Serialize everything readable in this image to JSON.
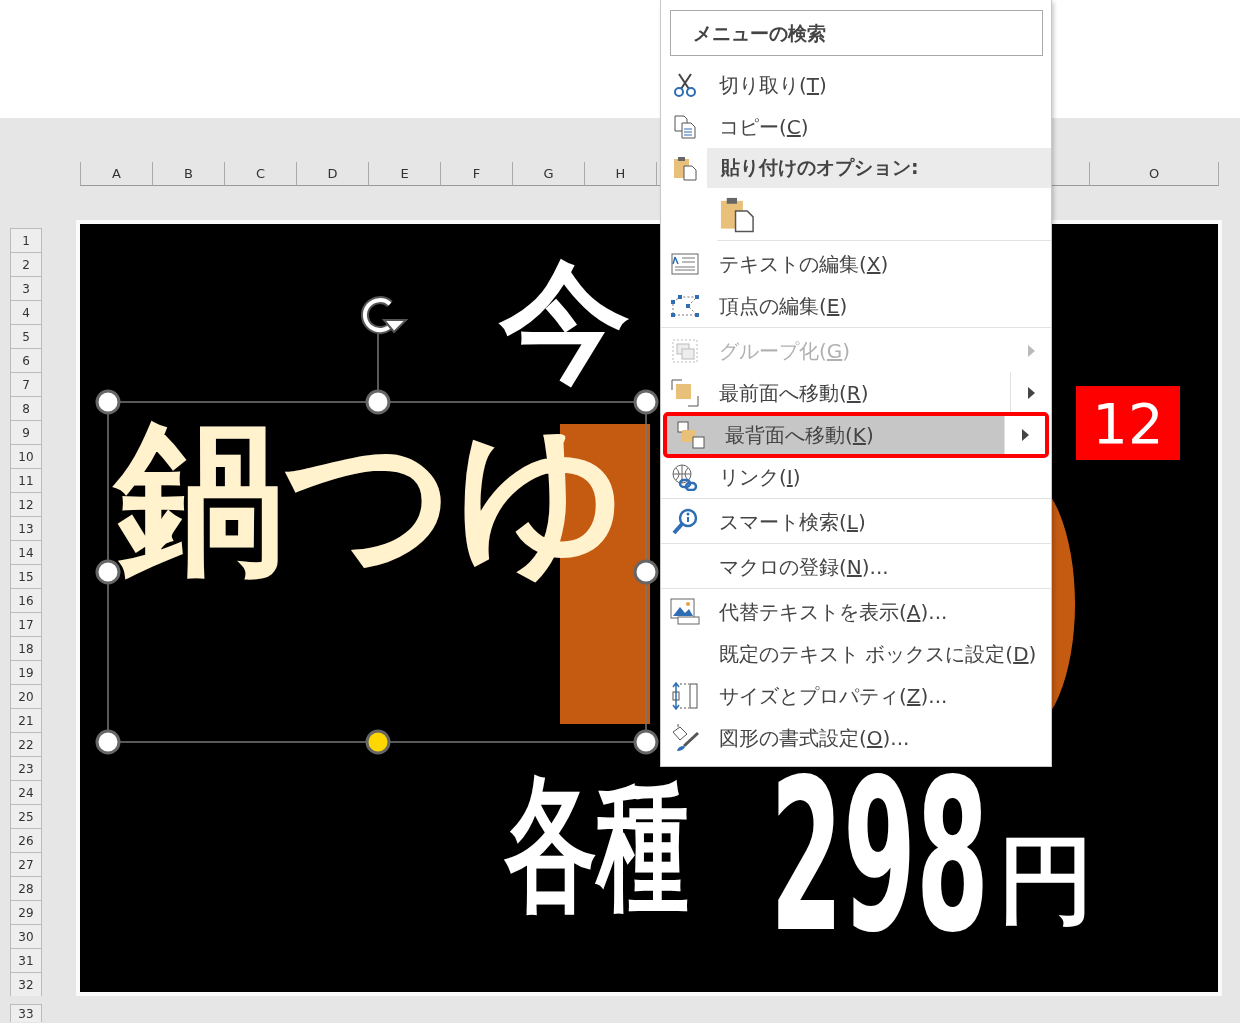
{
  "sheet": {
    "columns": [
      "A",
      "B",
      "C",
      "D",
      "E",
      "F",
      "G",
      "H"
    ],
    "column_right": "O",
    "rows": [
      "1",
      "2",
      "3",
      "4",
      "5",
      "6",
      "7",
      "8",
      "9",
      "10",
      "11",
      "12",
      "13",
      "14",
      "15",
      "16",
      "17",
      "18",
      "19",
      "20",
      "21",
      "22",
      "23",
      "24",
      "25",
      "26",
      "27",
      "28",
      "29",
      "30",
      "31",
      "32"
    ],
    "row_below": "33"
  },
  "poster": {
    "texts": [
      {
        "text": "今",
        "color": "#ffffff"
      },
      {
        "text": "鍋つゆ",
        "color": "#fff2cc"
      },
      {
        "text": "各種",
        "color": "#ffffff"
      },
      {
        "text": "298",
        "color": "#ffffff"
      },
      {
        "text": "円",
        "color": "#ffffff"
      }
    ]
  },
  "context_menu": {
    "search": {
      "placeholder": "メニューの検索"
    },
    "items": [
      {
        "kind": "command",
        "text": "切り取り(",
        "access_key": "T",
        "text_after": ")",
        "disabled": false,
        "submenu": false,
        "selected": false,
        "separator_after": false
      },
      {
        "kind": "command",
        "text": "コピー(",
        "access_key": "C",
        "text_after": ")",
        "disabled": false,
        "submenu": false,
        "selected": false,
        "separator_after": false
      },
      {
        "kind": "header",
        "text": "貼り付けのオプション:"
      },
      {
        "kind": "paste-button",
        "separator_after": true
      },
      {
        "kind": "command",
        "text": "テキストの編集(",
        "access_key": "X",
        "text_after": ")",
        "disabled": false,
        "submenu": false,
        "selected": false,
        "separator_after": false
      },
      {
        "kind": "command",
        "text": "頂点の編集(",
        "access_key": "E",
        "text_after": ")",
        "disabled": false,
        "submenu": false,
        "selected": false,
        "separator_after": true
      },
      {
        "kind": "command",
        "text": "グループ化(",
        "access_key": "G",
        "text_after": ")",
        "disabled": true,
        "submenu": true,
        "selected": false,
        "separator_after": false
      },
      {
        "kind": "command",
        "text": "最前面へ移動(",
        "access_key": "R",
        "text_after": ")",
        "disabled": false,
        "submenu": true,
        "selected": false,
        "separator_after": false
      },
      {
        "kind": "command",
        "text": "最背面へ移動(",
        "access_key": "K",
        "text_after": ")",
        "disabled": false,
        "submenu": true,
        "selected": true,
        "separator_after": false
      },
      {
        "kind": "command",
        "text": "リンク(",
        "access_key": "I",
        "text_after": ")",
        "disabled": false,
        "submenu": false,
        "selected": false,
        "separator_after": true
      },
      {
        "kind": "command",
        "text": "スマート検索(",
        "access_key": "L",
        "text_after": ")",
        "disabled": false,
        "submenu": false,
        "selected": false,
        "separator_after": true
      },
      {
        "kind": "command",
        "text": "マクロの登録(",
        "access_key": "N",
        "text_after": ")...",
        "disabled": false,
        "submenu": false,
        "selected": false,
        "separator_after": true
      },
      {
        "kind": "command",
        "text": "代替テキストを表示(",
        "access_key": "A",
        "text_after": ")...",
        "disabled": false,
        "submenu": false,
        "selected": false,
        "separator_after": false
      },
      {
        "kind": "command",
        "text": "既定のテキスト ボックスに設定(",
        "access_key": "D",
        "text_after": ")",
        "disabled": false,
        "submenu": false,
        "selected": false,
        "separator_after": false
      },
      {
        "kind": "command",
        "text": "サイズとプロパティ(",
        "access_key": "Z",
        "text_after": ")...",
        "disabled": false,
        "submenu": false,
        "selected": false,
        "separator_after": false
      },
      {
        "kind": "command",
        "text": "図形の書式設定(",
        "access_key": "O",
        "text_after": ")...",
        "disabled": false,
        "submenu": false,
        "selected": false,
        "separator_after": false
      }
    ]
  },
  "step_badge": {
    "text": "12"
  }
}
